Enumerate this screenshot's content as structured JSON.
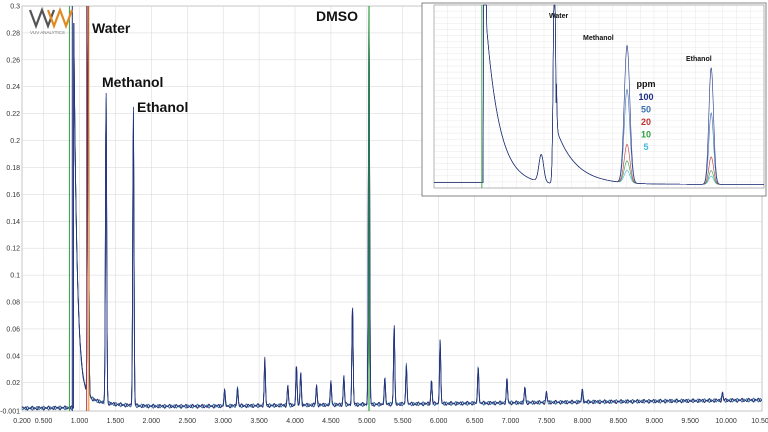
{
  "chart_data": [
    {
      "type": "line",
      "logo_text": "VUV ANALYTICS",
      "annotations": [
        "Water",
        "Methanol",
        "Ethanol",
        "DMSO"
      ],
      "x_ticks": [
        "0.200",
        "0.500",
        "1.000",
        "1.500",
        "2.000",
        "2.500",
        "3.000",
        "3.500",
        "4.000",
        "4.500",
        "5.000",
        "5.500",
        "6.000",
        "6.500",
        "7.000",
        "7.500",
        "8.000",
        "8.500",
        "9.000",
        "9.500",
        "10.000",
        "10.500"
      ],
      "y_ticks": [
        "-0.001",
        "0.02",
        "0.04",
        "0.06",
        "0.08",
        "0.1",
        "0.12",
        "0.14",
        "0.16",
        "0.18",
        "0.2",
        "0.22",
        "0.24",
        "0.26",
        "0.28",
        "0.3"
      ],
      "xlim": [
        0.2,
        10.5
      ],
      "ylim": [
        -0.001,
        0.3
      ],
      "grid": true,
      "series_colors": [
        "#1f2f80",
        "#3a6fb0",
        "#c03030",
        "#30a040",
        "#40b8e0"
      ],
      "peaks": [
        {
          "label": "Methanol",
          "x": 1.37,
          "y": 0.235
        },
        {
          "label": "Ethanol",
          "x": 1.75,
          "y": 0.225
        },
        {
          "label": "DMSO",
          "x": 5.03,
          "y": 0.3
        }
      ],
      "minor_peaks": [
        {
          "x": 3.02,
          "y": 0.012
        },
        {
          "x": 3.2,
          "y": 0.014
        },
        {
          "x": 3.58,
          "y": 0.035
        },
        {
          "x": 3.9,
          "y": 0.015
        },
        {
          "x": 4.02,
          "y": 0.03
        },
        {
          "x": 4.08,
          "y": 0.025
        },
        {
          "x": 4.3,
          "y": 0.015
        },
        {
          "x": 4.5,
          "y": 0.018
        },
        {
          "x": 4.68,
          "y": 0.022
        },
        {
          "x": 4.8,
          "y": 0.075
        },
        {
          "x": 5.25,
          "y": 0.02
        },
        {
          "x": 5.38,
          "y": 0.06
        },
        {
          "x": 5.55,
          "y": 0.03
        },
        {
          "x": 5.9,
          "y": 0.018
        },
        {
          "x": 6.02,
          "y": 0.048
        },
        {
          "x": 6.55,
          "y": 0.028
        },
        {
          "x": 6.95,
          "y": 0.018
        },
        {
          "x": 7.2,
          "y": 0.012
        },
        {
          "x": 7.5,
          "y": 0.008
        },
        {
          "x": 8.0,
          "y": 0.01
        },
        {
          "x": 9.95,
          "y": 0.006
        }
      ]
    },
    {
      "type": "line",
      "annotations": [
        "Water",
        "Methanol",
        "Ethanol"
      ],
      "legend_title": "ppm",
      "legend": [
        "100",
        "50",
        "20",
        "10",
        "5"
      ],
      "series_colors": [
        "#1f2f80",
        "#3a6fb0",
        "#c03030",
        "#30a040",
        "#40b8e0"
      ],
      "peak_heights": {
        "Methanol": [
          1.0,
          0.68,
          0.28,
          0.16,
          0.09
        ],
        "Ethanol": [
          0.85,
          0.52,
          0.2,
          0.1,
          0.06
        ]
      }
    }
  ]
}
